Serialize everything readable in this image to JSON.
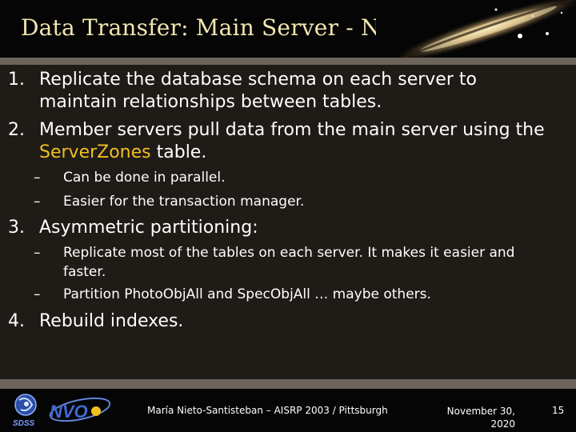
{
  "header": {
    "title": "Data Transfer: Main Server - Nodes"
  },
  "items": [
    {
      "num": "1.",
      "text": "Replicate the database schema on each server to maintain relationships between tables."
    },
    {
      "num": "2.",
      "text_before": "Member servers pull data from the main server using the ",
      "highlight": "ServerZones",
      "text_after": " table."
    },
    {
      "dash": "–",
      "text": "Can be done in parallel."
    },
    {
      "dash": "–",
      "text": "Easier for the transaction manager."
    },
    {
      "num": "3.",
      "text": "Asymmetric partitioning:"
    },
    {
      "dash": "–",
      "text": "Replicate most of the tables on each server.  It makes it easier and faster."
    },
    {
      "dash": "–",
      "text": "Partition PhotoObjAll and SpecObjAll … maybe others."
    },
    {
      "num": "4.",
      "text": "Rebuild indexes."
    }
  ],
  "footer": {
    "logo1": "SDSS",
    "logo2": "NVO",
    "author": "María Nieto-Santisteban – AISRP 2003 / Pittsburgh",
    "date": "November 30, 2020",
    "page": "15"
  },
  "colors": {
    "background": "#1f1b17",
    "title": "#f2e6b0",
    "highlight": "#f0c020",
    "band": "#6d645b"
  }
}
